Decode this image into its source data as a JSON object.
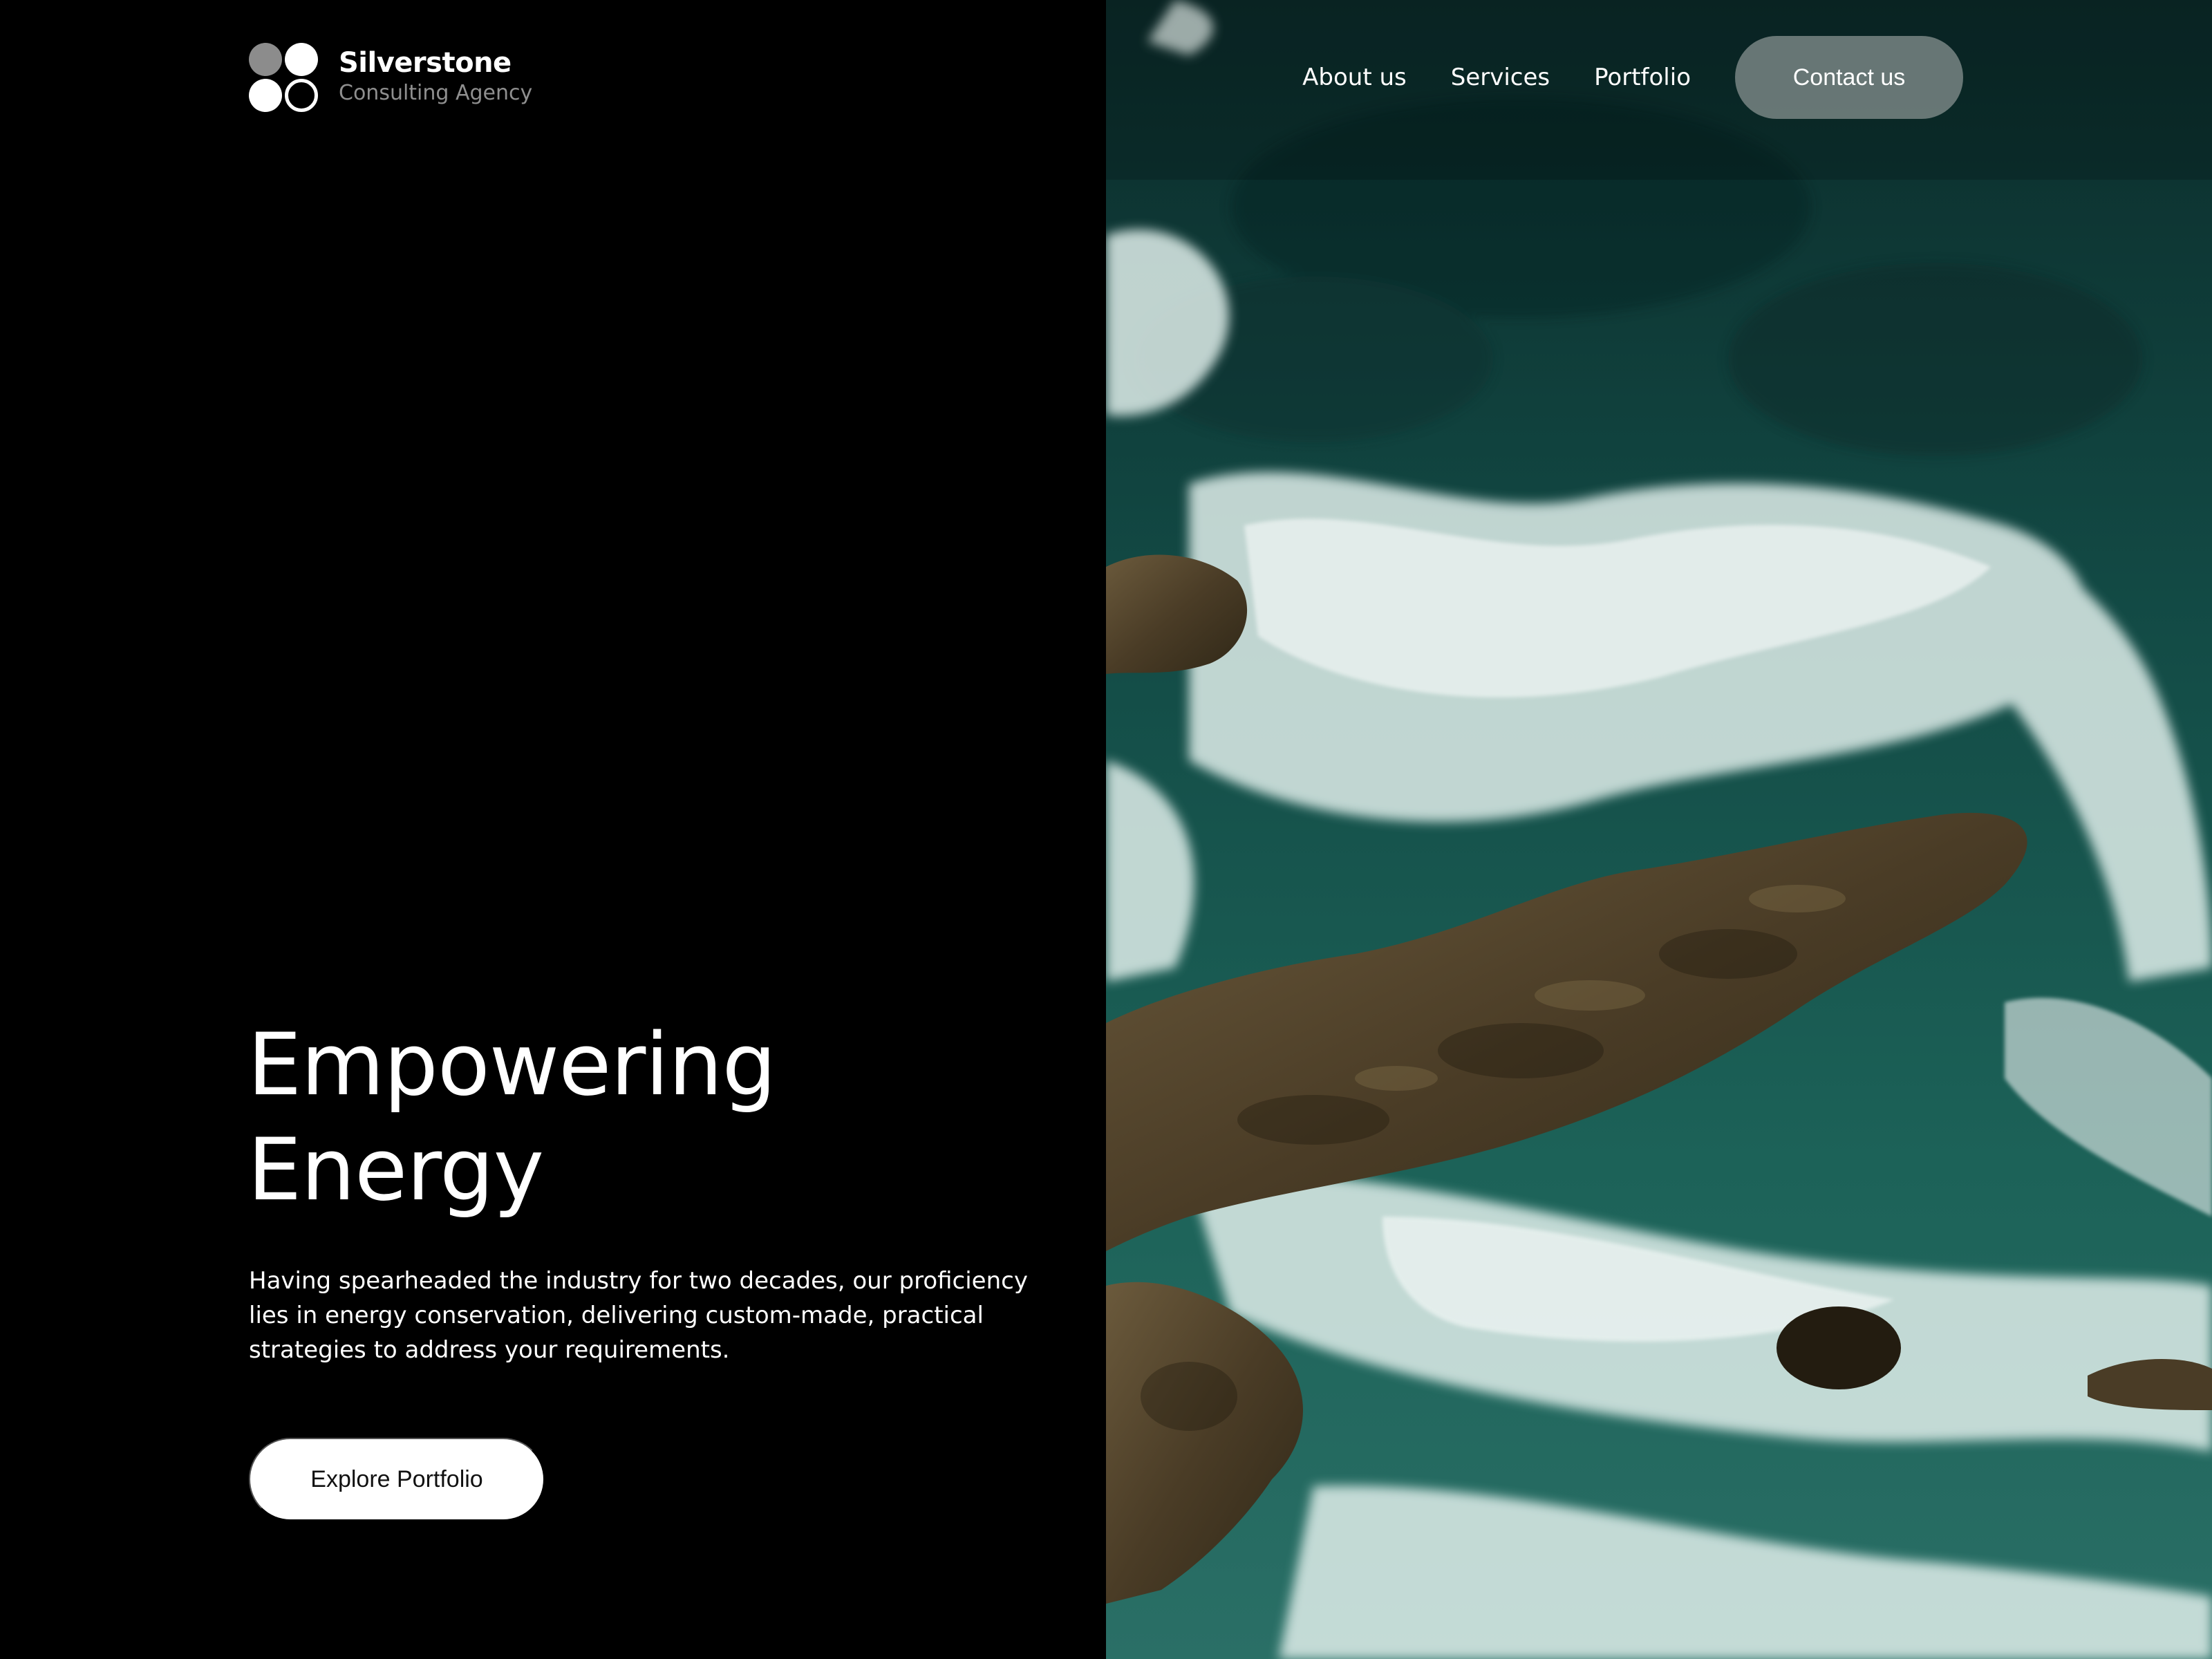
{
  "brand": {
    "name": "Silverstone",
    "tagline": "Consulting Agency"
  },
  "nav": {
    "items": [
      {
        "label": "About us"
      },
      {
        "label": "Services"
      },
      {
        "label": "Portfolio"
      }
    ],
    "cta_label": "Contact us"
  },
  "hero": {
    "title_line1": "Empowering",
    "title_line2": "Energy",
    "description": "Having spearheaded the industry for two decades, our proficiency lies in energy conservation, delivering custom-made, practical strategies to address your requirements.",
    "button_label": "Explore Portfolio"
  },
  "theme": {
    "background": "#000000",
    "text": "#ffffff",
    "muted_text": "#8f8f8f",
    "cta_background": "#8c9694",
    "water": "#0f3a38",
    "foam": "#e6f0ee",
    "rock": "#5a4a30"
  },
  "image": {
    "subject": "aerial-ocean-waves-rocks"
  }
}
